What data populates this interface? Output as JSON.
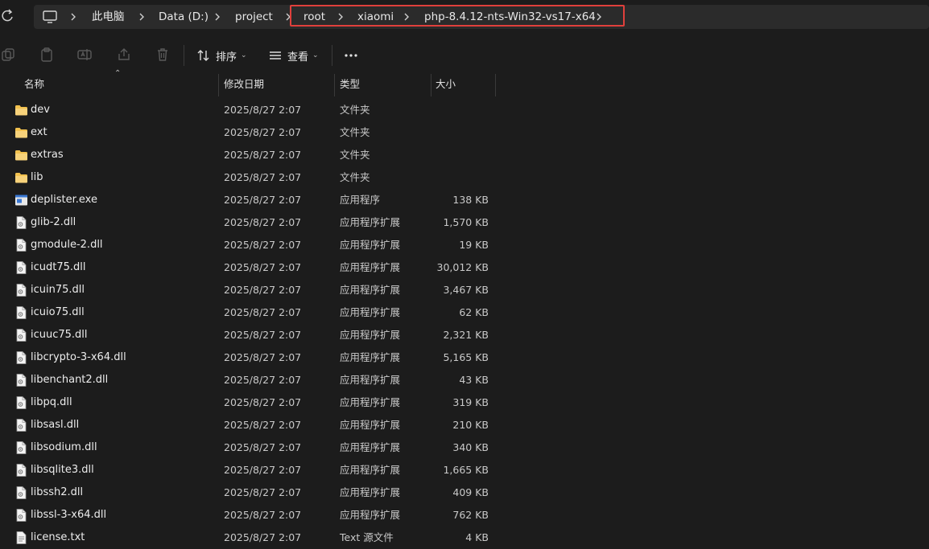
{
  "breadcrumb": {
    "items": [
      "此电脑",
      "Data (D:)",
      "project",
      "root",
      "xiaomi",
      "php-8.4.12-nts-Win32-vs17-x64"
    ]
  },
  "toolbar": {
    "sort_label": "排序",
    "view_label": "查看",
    "more_label": "···"
  },
  "columns": {
    "name": "名称",
    "modified": "修改日期",
    "type": "类型",
    "size": "大小"
  },
  "files": [
    {
      "name": "dev",
      "modified": "2025/8/27 2:07",
      "type": "文件夹",
      "size": "",
      "icon": "folder-icon"
    },
    {
      "name": "ext",
      "modified": "2025/8/27 2:07",
      "type": "文件夹",
      "size": "",
      "icon": "folder-icon"
    },
    {
      "name": "extras",
      "modified": "2025/8/27 2:07",
      "type": "文件夹",
      "size": "",
      "icon": "folder-icon"
    },
    {
      "name": "lib",
      "modified": "2025/8/27 2:07",
      "type": "文件夹",
      "size": "",
      "icon": "folder-icon"
    },
    {
      "name": "deplister.exe",
      "modified": "2025/8/27 2:07",
      "type": "应用程序",
      "size": "138 KB",
      "icon": "exe-icon"
    },
    {
      "name": "glib-2.dll",
      "modified": "2025/8/27 2:07",
      "type": "应用程序扩展",
      "size": "1,570 KB",
      "icon": "dll-icon"
    },
    {
      "name": "gmodule-2.dll",
      "modified": "2025/8/27 2:07",
      "type": "应用程序扩展",
      "size": "19 KB",
      "icon": "dll-icon"
    },
    {
      "name": "icudt75.dll",
      "modified": "2025/8/27 2:07",
      "type": "应用程序扩展",
      "size": "30,012 KB",
      "icon": "dll-icon"
    },
    {
      "name": "icuin75.dll",
      "modified": "2025/8/27 2:07",
      "type": "应用程序扩展",
      "size": "3,467 KB",
      "icon": "dll-icon"
    },
    {
      "name": "icuio75.dll",
      "modified": "2025/8/27 2:07",
      "type": "应用程序扩展",
      "size": "62 KB",
      "icon": "dll-icon"
    },
    {
      "name": "icuuc75.dll",
      "modified": "2025/8/27 2:07",
      "type": "应用程序扩展",
      "size": "2,321 KB",
      "icon": "dll-icon"
    },
    {
      "name": "libcrypto-3-x64.dll",
      "modified": "2025/8/27 2:07",
      "type": "应用程序扩展",
      "size": "5,165 KB",
      "icon": "dll-icon"
    },
    {
      "name": "libenchant2.dll",
      "modified": "2025/8/27 2:07",
      "type": "应用程序扩展",
      "size": "43 KB",
      "icon": "dll-icon"
    },
    {
      "name": "libpq.dll",
      "modified": "2025/8/27 2:07",
      "type": "应用程序扩展",
      "size": "319 KB",
      "icon": "dll-icon"
    },
    {
      "name": "libsasl.dll",
      "modified": "2025/8/27 2:07",
      "type": "应用程序扩展",
      "size": "210 KB",
      "icon": "dll-icon"
    },
    {
      "name": "libsodium.dll",
      "modified": "2025/8/27 2:07",
      "type": "应用程序扩展",
      "size": "340 KB",
      "icon": "dll-icon"
    },
    {
      "name": "libsqlite3.dll",
      "modified": "2025/8/27 2:07",
      "type": "应用程序扩展",
      "size": "1,665 KB",
      "icon": "dll-icon"
    },
    {
      "name": "libssh2.dll",
      "modified": "2025/8/27 2:07",
      "type": "应用程序扩展",
      "size": "409 KB",
      "icon": "dll-icon"
    },
    {
      "name": "libssl-3-x64.dll",
      "modified": "2025/8/27 2:07",
      "type": "应用程序扩展",
      "size": "762 KB",
      "icon": "dll-icon"
    },
    {
      "name": "license.txt",
      "modified": "2025/8/27 2:07",
      "type": "Text 源文件",
      "size": "4 KB",
      "icon": "text-file-icon"
    }
  ],
  "colors": {
    "background": "#1c1c1c",
    "breadcrumb_bg": "#2b2b2b",
    "highlight_border": "#e0403c",
    "folder": "#f2c14e"
  }
}
